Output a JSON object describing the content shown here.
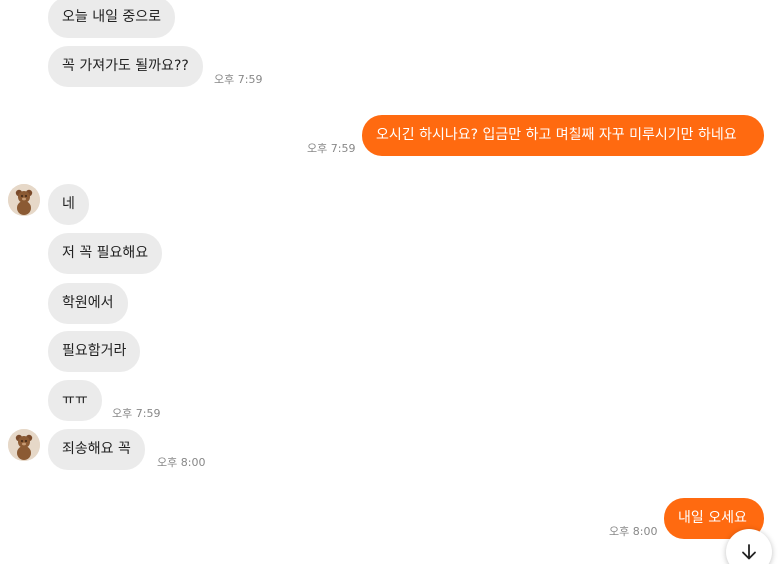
{
  "messages": [
    {
      "text": "오늘 내일 중으로"
    },
    {
      "text": "꼭 가져가도 될까요??",
      "time": "오후 7:59"
    },
    {
      "text": "오시긴 하시나요? 입금만 하고 며칠째 자꾸 미루시기만 하네요",
      "time": "오후 7:59"
    },
    {
      "text": "네"
    },
    {
      "text": "저 꼭 필요해요"
    },
    {
      "text": "학원에서"
    },
    {
      "text": "필요함거라"
    },
    {
      "text": "ㅠㅠ",
      "time": "오후 7:59"
    },
    {
      "text": "죄송해요 꼭",
      "time": "오후 8:00"
    },
    {
      "text": "내일 오세요",
      "time": "오후 8:00"
    }
  ],
  "icons": {
    "avatar": "teddy-bear-avatar",
    "scroll_down": "arrow-down-icon"
  },
  "colors": {
    "outgoing_bubble": "#ff6a10",
    "incoming_bubble": "#ebebeb"
  }
}
